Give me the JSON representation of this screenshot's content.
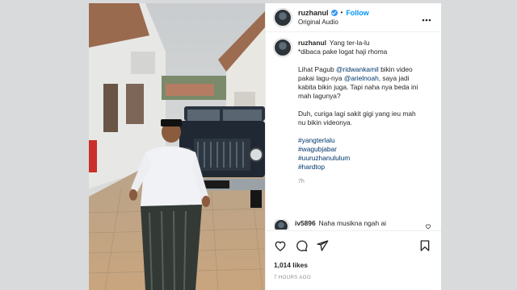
{
  "post": {
    "username": "ruzhanul",
    "follow_label": "Follow",
    "separator": "•",
    "audio_label": "Original Audio",
    "caption_lines": [
      "Yang ter-la-lu",
      "*dibaca pake logat haji rhoma",
      "",
      "Lihat Pagub @ridwankamil bikin video",
      "pakai lagu-nya @arielnoah, saya jadi",
      "kabita bikin juga. Tapi naha nya beda ini",
      "mah lagunya?",
      "",
      "Duh, curiga lagi sakit gigi yang ieu mah",
      "nu bikin videonya."
    ],
    "hashtags": [
      "#yangterlalu",
      "#wagubjabar",
      "#uuruzhanululum",
      "#hardtop"
    ],
    "caption_age": "7h",
    "comment": {
      "username": "iv5896",
      "text": "Naha musikna ngah ai"
    },
    "likes": "1,014 likes",
    "timestamp": "7 HOURS AGO"
  },
  "icons": {
    "more": "more-options-icon",
    "like": "heart-icon",
    "comment": "comment-icon",
    "share": "share-icon",
    "save": "bookmark-icon",
    "verified": "verified-badge-icon"
  },
  "colors": {
    "accent": "#0095f6",
    "verified": "#3897f0",
    "hashtag": "#00376b",
    "muted": "#8e8e8e"
  }
}
